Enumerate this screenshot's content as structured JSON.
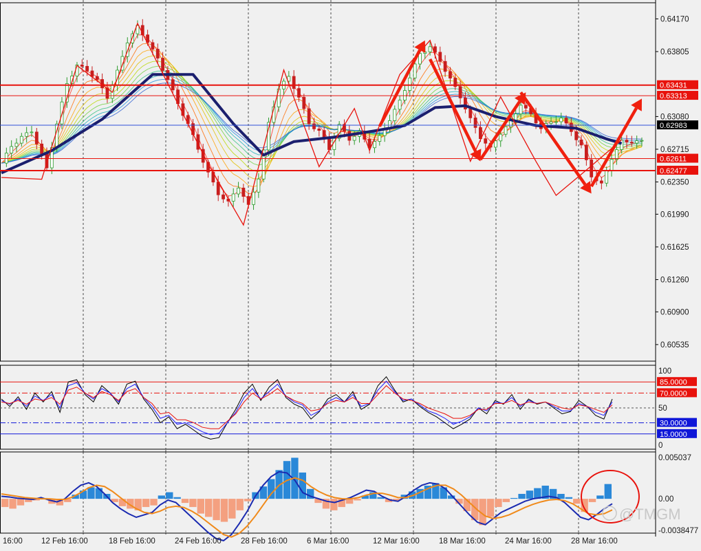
{
  "chart_data": [
    {
      "panel": "price",
      "type": "candlestick",
      "instrument_axis_ticks": [
        "0.64170",
        "0.63805",
        "0.63080",
        "0.62715",
        "0.62350",
        "0.61990",
        "0.61625",
        "0.61260",
        "0.60900",
        "0.60535"
      ],
      "ylim": [
        0.6035,
        0.6435
      ],
      "level_tags": [
        {
          "label": "0.63431",
          "value": 0.63431,
          "color": "#e8120c"
        },
        {
          "label": "0.63313",
          "value": 0.63313,
          "color": "#e8120c"
        },
        {
          "label": "0.62983",
          "value": 0.62983,
          "color": "#000000"
        },
        {
          "label": "0.62611",
          "value": 0.62611,
          "color": "#e8120c"
        },
        {
          "label": "0.62477",
          "value": 0.62477,
          "color": "#e8120c"
        }
      ],
      "horizontal_lines": [
        {
          "value": 0.63431,
          "color": "#e8120c",
          "width": 2
        },
        {
          "value": 0.63313,
          "color": "#e8120c",
          "width": 1
        },
        {
          "value": 0.62983,
          "color": "#3050d8",
          "width": 1
        },
        {
          "value": 0.62611,
          "color": "#e8120c",
          "width": 1
        },
        {
          "value": 0.62477,
          "color": "#e8120c",
          "width": 2
        }
      ],
      "close_path": [
        [
          0,
          0.6256
        ],
        [
          2,
          0.6275
        ],
        [
          4,
          0.6285
        ],
        [
          6,
          0.6292
        ],
        [
          8,
          0.6265
        ],
        [
          9,
          0.625
        ],
        [
          11,
          0.63
        ],
        [
          13,
          0.6345
        ],
        [
          15,
          0.6365
        ],
        [
          17,
          0.636
        ],
        [
          19,
          0.6348
        ],
        [
          21,
          0.633
        ],
        [
          23,
          0.6358
        ],
        [
          25,
          0.6392
        ],
        [
          27,
          0.6408
        ],
        [
          29,
          0.6392
        ],
        [
          31,
          0.6372
        ],
        [
          33,
          0.635
        ],
        [
          35,
          0.6322
        ],
        [
          37,
          0.63
        ],
        [
          39,
          0.6272
        ],
        [
          41,
          0.6245
        ],
        [
          43,
          0.6222
        ],
        [
          45,
          0.6212
        ],
        [
          47,
          0.623
        ],
        [
          49,
          0.6208
        ],
        [
          51,
          0.624
        ],
        [
          53,
          0.63
        ],
        [
          55,
          0.634
        ],
        [
          57,
          0.6352
        ],
        [
          59,
          0.633
        ],
        [
          61,
          0.63
        ],
        [
          63,
          0.6292
        ],
        [
          65,
          0.6272
        ],
        [
          67,
          0.6298
        ],
        [
          69,
          0.6283
        ],
        [
          71,
          0.629
        ],
        [
          73,
          0.6275
        ],
        [
          75,
          0.6285
        ],
        [
          77,
          0.6305
        ],
        [
          79,
          0.6325
        ],
        [
          81,
          0.6352
        ],
        [
          83,
          0.6378
        ],
        [
          85,
          0.6386
        ],
        [
          87,
          0.637
        ],
        [
          89,
          0.635
        ],
        [
          91,
          0.633
        ],
        [
          93,
          0.6305
        ],
        [
          95,
          0.6285
        ],
        [
          97,
          0.6272
        ],
        [
          99,
          0.629
        ],
        [
          101,
          0.6302
        ],
        [
          103,
          0.6322
        ],
        [
          105,
          0.631
        ],
        [
          107,
          0.6295
        ],
        [
          109,
          0.6302
        ],
        [
          111,
          0.6306
        ],
        [
          113,
          0.6292
        ],
        [
          115,
          0.6275
        ],
        [
          117,
          0.6242
        ],
        [
          119,
          0.6232
        ],
        [
          121,
          0.6262
        ],
        [
          123,
          0.628
        ]
      ],
      "ma_thick": [
        [
          0,
          0.6245
        ],
        [
          10,
          0.627
        ],
        [
          20,
          0.6305
        ],
        [
          30,
          0.6355
        ],
        [
          38,
          0.6355
        ],
        [
          46,
          0.63
        ],
        [
          52,
          0.6265
        ],
        [
          58,
          0.628
        ],
        [
          66,
          0.6285
        ],
        [
          74,
          0.6292
        ],
        [
          80,
          0.6298
        ],
        [
          86,
          0.6318
        ],
        [
          92,
          0.632
        ],
        [
          98,
          0.6308
        ],
        [
          106,
          0.6298
        ],
        [
          114,
          0.6295
        ],
        [
          120,
          0.6283
        ],
        [
          123,
          0.6278
        ]
      ],
      "zigzag": [
        [
          0,
          0.624
        ],
        [
          8,
          0.6238
        ],
        [
          15,
          0.6365
        ],
        [
          22,
          0.6335
        ],
        [
          27,
          0.6412
        ],
        [
          41,
          0.6255
        ],
        [
          48,
          0.6187
        ],
        [
          56,
          0.636
        ],
        [
          63,
          0.6252
        ],
        [
          70,
          0.6317
        ],
        [
          73,
          0.627
        ],
        [
          79,
          0.6355
        ],
        [
          85,
          0.6393
        ],
        [
          93,
          0.6258
        ],
        [
          99,
          0.633
        ],
        [
          106,
          0.6258
        ],
        [
          110,
          0.622
        ],
        [
          117,
          0.6253
        ],
        [
          123,
          0.6282
        ]
      ],
      "arrows": [
        {
          "from": [
            75,
            0.6297
          ],
          "to": [
            84,
            0.6393
          ]
        },
        {
          "from": [
            85,
            0.6372
          ],
          "to": [
            95,
            0.6258
          ]
        },
        {
          "from": [
            95,
            0.626
          ],
          "to": [
            104,
            0.6335
          ]
        },
        {
          "from": [
            103,
            0.6335
          ],
          "to": [
            117,
            0.6222
          ]
        },
        {
          "from": [
            117,
            0.623
          ],
          "to": [
            127,
            0.6328
          ]
        }
      ]
    },
    {
      "panel": "oscillator",
      "type": "line",
      "ylim": [
        0,
        100
      ],
      "axis_ticks": [
        "100",
        "50",
        "0"
      ],
      "level_tags": [
        {
          "label": "85.0000",
          "value": 85,
          "color": "#e8120c"
        },
        {
          "label": "70.0000",
          "value": 70,
          "color": "#e8120c"
        },
        {
          "label": "30.0000",
          "value": 30,
          "color": "#0f17d8"
        },
        {
          "label": "15.0000",
          "value": 15,
          "color": "#0f17d8"
        }
      ],
      "series": [
        {
          "color": "#000000",
          "values": [
            62,
            52,
            65,
            48,
            70,
            58,
            72,
            44,
            85,
            88,
            68,
            58,
            80,
            70,
            55,
            82,
            86,
            62,
            48,
            30,
            38,
            22,
            28,
            20,
            12,
            8,
            10,
            30,
            48,
            70,
            82,
            60,
            78,
            88,
            64,
            55,
            50,
            35,
            45,
            62,
            68,
            58,
            72,
            48,
            55,
            80,
            92,
            74,
            58,
            62,
            52,
            44,
            38,
            30,
            22,
            28,
            35,
            50,
            42,
            60,
            55,
            68,
            48,
            62,
            55,
            58,
            50,
            42,
            45,
            60,
            52,
            40,
            35,
            62
          ]
        },
        {
          "color": "#1a1aff",
          "values": [
            60,
            55,
            62,
            52,
            66,
            60,
            68,
            50,
            80,
            84,
            70,
            62,
            76,
            70,
            58,
            76,
            82,
            64,
            52,
            36,
            40,
            28,
            30,
            24,
            18,
            14,
            16,
            30,
            44,
            64,
            76,
            62,
            72,
            82,
            66,
            58,
            54,
            40,
            46,
            58,
            64,
            58,
            68,
            52,
            56,
            74,
            86,
            72,
            60,
            62,
            54,
            46,
            42,
            36,
            28,
            32,
            38,
            50,
            46,
            58,
            56,
            64,
            52,
            60,
            56,
            58,
            52,
            46,
            46,
            56,
            52,
            44,
            40,
            58
          ]
        },
        {
          "color": "#e8120c",
          "values": [
            58,
            56,
            60,
            55,
            62,
            60,
            64,
            55,
            74,
            78,
            70,
            64,
            72,
            68,
            60,
            72,
            76,
            64,
            56,
            42,
            44,
            34,
            34,
            30,
            24,
            22,
            22,
            32,
            42,
            58,
            70,
            62,
            68,
            76,
            66,
            60,
            56,
            46,
            48,
            56,
            60,
            58,
            64,
            56,
            56,
            68,
            80,
            70,
            62,
            60,
            56,
            50,
            46,
            42,
            36,
            36,
            40,
            48,
            48,
            56,
            56,
            60,
            54,
            58,
            56,
            58,
            54,
            50,
            48,
            54,
            52,
            48,
            44,
            54
          ]
        }
      ]
    },
    {
      "panel": "macd",
      "type": "histogram+line",
      "axis_ticks": [
        "0.005037",
        "0.00",
        "-0.0038477"
      ],
      "ylim": [
        -0.0038477,
        0.005037
      ],
      "histogram": [
        -1.0,
        -1.2,
        -0.8,
        -0.4,
        -0.2,
        0.1,
        -0.6,
        -0.8,
        -0.4,
        0.5,
        1.0,
        1.4,
        1.3,
        0.6,
        -0.4,
        -0.9,
        -1.2,
        -1.4,
        -1.0,
        -0.8,
        0.4,
        0.8,
        0.2,
        -0.5,
        -1.0,
        -1.8,
        -2.2,
        -2.6,
        -2.8,
        -2.4,
        -1.4,
        -0.3,
        0.8,
        1.5,
        2.4,
        3.5,
        4.6,
        5.0,
        3.2,
        1.2,
        -0.5,
        -1.2,
        -1.4,
        -1.0,
        -0.6,
        -0.2,
        0.4,
        0.8,
        0.2,
        -0.4,
        -0.2,
        0.5,
        0.9,
        1.2,
        1.6,
        1.9,
        1.4,
        0.4,
        -0.6,
        -1.5,
        -2.6,
        -3.2,
        -2.2,
        -1.0,
        -0.4,
        0.1,
        0.6,
        1.0,
        1.3,
        1.6,
        1.2,
        0.6,
        0.2,
        -0.6,
        -1.6,
        -0.4,
        0.4,
        1.8
      ],
      "series": [
        {
          "name": "",
          "color": "#1a2ab0",
          "values": [
            0.4,
            0.3,
            0.1,
            0.0,
            -0.1,
            0.2,
            -0.2,
            -0.5,
            0.0,
            1.2,
            2.2,
            2.6,
            2.0,
            0.8,
            -0.6,
            -1.6,
            -2.4,
            -3.0,
            -2.6,
            -2.2,
            -1.0,
            -0.2,
            -0.6,
            -1.8,
            -3.0,
            -4.2,
            -5.4,
            -6.4,
            -6.8,
            -5.8,
            -4.0,
            -2.0,
            0.4,
            2.2,
            3.6,
            4.4,
            4.2,
            3.0,
            1.0,
            0.4,
            0.0,
            -0.4,
            -0.6,
            -0.2,
            0.2,
            0.8,
            1.4,
            1.2,
            0.4,
            -0.2,
            -0.4,
            0.4,
            1.4,
            2.2,
            2.6,
            2.4,
            1.6,
            0.2,
            -1.2,
            -2.6,
            -3.8,
            -4.2,
            -3.2,
            -2.2,
            -1.6,
            -1.0,
            -0.4,
            0.0,
            0.2,
            0.4,
            0.2,
            -0.6,
            -1.8,
            -3.0,
            -3.4,
            -2.6,
            -1.6,
            -0.8
          ]
        },
        {
          "name": "",
          "color": "#f08a1a",
          "values": [
            0.8,
            0.6,
            0.4,
            0.2,
            0.1,
            0.0,
            0.0,
            -0.1,
            -0.1,
            0.3,
            1.0,
            1.8,
            2.2,
            2.0,
            1.2,
            0.2,
            -0.8,
            -1.6,
            -2.2,
            -2.4,
            -2.0,
            -1.4,
            -1.2,
            -1.4,
            -2.0,
            -2.8,
            -3.8,
            -4.8,
            -5.8,
            -6.2,
            -5.6,
            -4.4,
            -2.8,
            -1.0,
            0.8,
            2.2,
            3.0,
            3.4,
            3.0,
            2.0,
            1.2,
            0.6,
            0.2,
            0.0,
            0.0,
            0.2,
            0.6,
            0.9,
            0.9,
            0.6,
            0.2,
            0.2,
            0.6,
            1.2,
            1.8,
            2.2,
            2.2,
            1.6,
            0.6,
            -0.6,
            -1.8,
            -2.8,
            -3.2,
            -3.0,
            -2.6,
            -2.0,
            -1.4,
            -0.9,
            -0.5,
            -0.2,
            -0.1,
            -0.3,
            -0.8,
            -1.6,
            -2.4,
            -2.6,
            -2.4,
            -1.8
          ]
        }
      ]
    }
  ],
  "x_labels": [
    "16:00",
    "12 Feb 16:00",
    "18 Feb 16:00",
    "24 Feb 16:00",
    "28 Feb 16:00",
    "6 Mar 16:00",
    "12 Mar 16:00",
    "18 Mar 16:00",
    "24 Mar 16:00",
    "28 Mar 16:00"
  ],
  "watermark": "@TMGM"
}
